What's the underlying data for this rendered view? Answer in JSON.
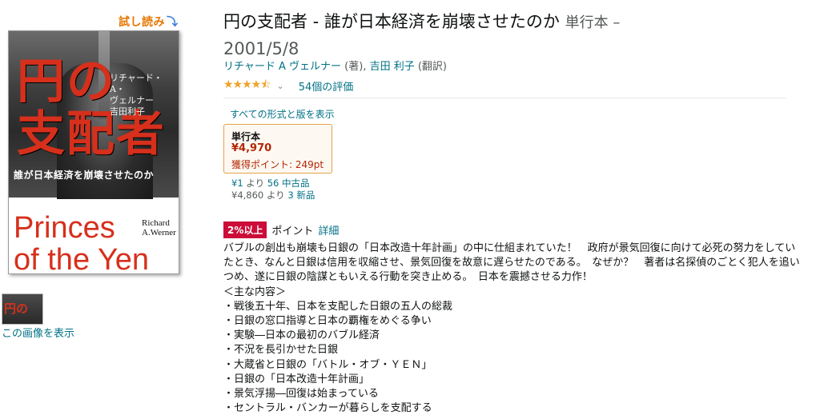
{
  "look_inside": {
    "label": "試し読み",
    "arrow": "⤵"
  },
  "cover": {
    "title_jp": "円の支配者",
    "authors_jp": [
      "リチャード・A・",
      "ヴェルナー",
      "吉田利子"
    ],
    "subtitle_jp": "誰が日本経済を崩壊させたのか",
    "title_en": [
      "Princes",
      "of the Yen"
    ],
    "author_en": [
      "Richard",
      "A.Werner"
    ]
  },
  "thumbnail": {
    "label": "円の"
  },
  "view_image_link": "この画像を表示",
  "product": {
    "title": "円の支配者 - 誰が日本経済を崩壊させたのか",
    "binding": "単行本 –",
    "date": "2001/5/8",
    "author1_name": "リチャード A ヴェルナー",
    "author1_role": " (著), ",
    "author2_name": "吉田 利子",
    "author2_role": " (翻訳)",
    "stars": "★★★★⯪",
    "rating_value": 4.5,
    "rating_chevron": "⌄",
    "ratings_count": "54個の評価"
  },
  "formats": {
    "all_formats_link": "すべての形式と版を表示",
    "selected": {
      "name": "単行本",
      "price": "¥4,970",
      "points": "獲得ポイント: 249pt"
    },
    "used": {
      "price": "¥1",
      "from": " より ",
      "link": "56 中古品"
    },
    "new": {
      "price": "¥4,860",
      "from": " より ",
      "link": "3 新品"
    }
  },
  "points": {
    "badge": "2%以上",
    "label": "ポイント",
    "detail_link": "詳細"
  },
  "description": {
    "intro": "バブルの創出も崩壊も日銀の「日本改造十年計画」の中に仕組まれていた！　政府が景気回復に向けて必死の努力をしていたとき、なんと日銀は信用を収縮させ、景気回復を故意に遅らせたのである。　なぜか？　著者は名探偵のごとく犯人を追いつめ、遂に日銀の陰謀ともいえる行動を突き止める。　日本を震撼させる力作！",
    "toc_heading": "＜主な内容＞",
    "toc": [
      "・戦後五十年、日本を支配した日銀の五人の総裁",
      "・日銀の窓口指導と日本の覇権をめぐる争い",
      "・実験―日本の最初のバブル経済",
      "・不況を長引かせた日銀",
      "・大蔵省と日銀の「バトル・オブ・ＹＥＮ」",
      "・日銀の「日本改造十年計画」",
      "・景気浮揚―回復は始まっている",
      "・セントラル・バンカーが暮らしを支配する"
    ]
  },
  "colors": {
    "link": "#007185",
    "price": "#b12704",
    "badge": "#cc0c39",
    "stars": "#f0a229",
    "look_inside": "#e77600",
    "cover_red": "#d6301c"
  }
}
